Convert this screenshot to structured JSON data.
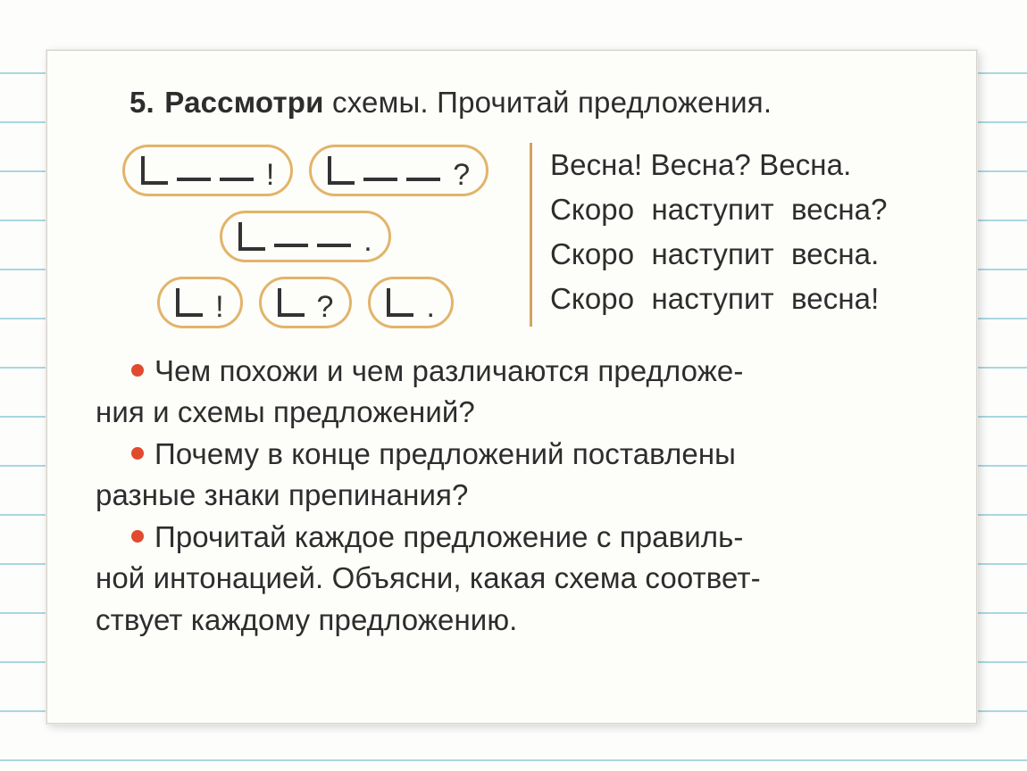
{
  "task": {
    "number": "5.",
    "verb": "Рассмотри",
    "rest": " схемы. Прочитай предложения."
  },
  "schemes": {
    "row1": {
      "a": {
        "words": 2,
        "punct": "!"
      },
      "b": {
        "words": 2,
        "punct": "?"
      }
    },
    "row2": {
      "a": {
        "words": 2,
        "punct": "."
      }
    },
    "row3": {
      "a": {
        "words": 0,
        "punct": "!"
      },
      "b": {
        "words": 0,
        "punct": "?"
      },
      "c": {
        "words": 0,
        "punct": "."
      }
    }
  },
  "sentences": {
    "l1": "Весна! Весна? Весна.",
    "l2": "Скоро наступит весна?",
    "l3": "Скоро наступит весна.",
    "l4": "Скоро наступит весна!"
  },
  "questions": {
    "q1a": "Чем похожи и чем различаются предложе-",
    "q1b": "ния и схемы предложений?",
    "q2a": "Почему в конце предложений поставлены",
    "q2b": "разные знаки препинания?",
    "q3a": "Прочитай каждое предложение с правиль-",
    "q3b": "ной интонацией. Объясни, какая схема соответ-",
    "q3c": "ствует каждому предложению."
  }
}
